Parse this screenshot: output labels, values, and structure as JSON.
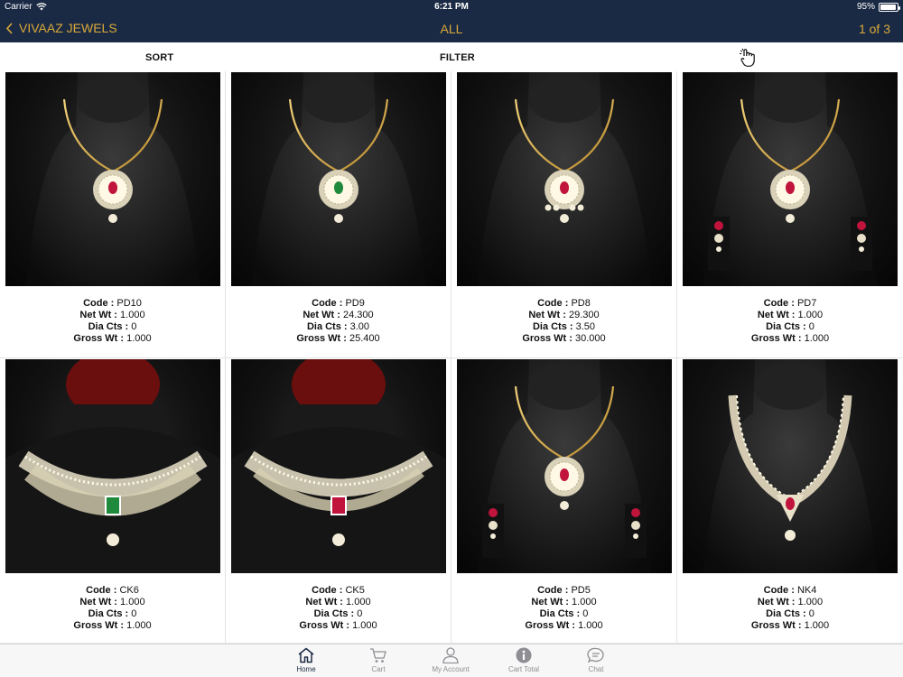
{
  "status_bar": {
    "carrier": "Carrier",
    "time": "6:21 PM",
    "battery": "95%",
    "battery_level": 0.95
  },
  "nav": {
    "back_label": "VIVAAZ JEWELS",
    "title": "ALL",
    "page_indicator": "1 of 3",
    "accent_color": "#d9a93a",
    "bg_color": "#1b2a44"
  },
  "toolbar": {
    "sort_label": "SORT",
    "filter_label": "FILTER",
    "hand_icon": "hand-pointer-icon"
  },
  "labels": {
    "code": "Code :",
    "net_wt": "Net Wt :",
    "dia_cts": "Dia Cts :",
    "gross_wt": "Gross Wt :"
  },
  "products": [
    {
      "code": "PD10",
      "net_wt": "1.000",
      "dia_cts": "0",
      "gross_wt": "1.000",
      "style": "pendant",
      "stone": "#c0143c"
    },
    {
      "code": "PD9",
      "net_wt": "24.300",
      "dia_cts": "3.00",
      "gross_wt": "25.400",
      "style": "pendant",
      "stone": "#1f8a3c"
    },
    {
      "code": "PD8",
      "net_wt": "29.300",
      "dia_cts": "3.50",
      "gross_wt": "30.000",
      "style": "pendant-drops",
      "stone": "#c0143c"
    },
    {
      "code": "PD7",
      "net_wt": "1.000",
      "dia_cts": "0",
      "gross_wt": "1.000",
      "style": "pendant-earrings",
      "stone": "#c0143c"
    },
    {
      "code": "CK6",
      "net_wt": "1.000",
      "dia_cts": "0",
      "gross_wt": "1.000",
      "style": "choker",
      "stone": "#1f8a3c"
    },
    {
      "code": "CK5",
      "net_wt": "1.000",
      "dia_cts": "0",
      "gross_wt": "1.000",
      "style": "choker-lace",
      "stone": "#c0143c"
    },
    {
      "code": "PD5",
      "net_wt": "1.000",
      "dia_cts": "0",
      "gross_wt": "1.000",
      "style": "pendant-earrings",
      "stone": "#c0143c"
    },
    {
      "code": "NK4",
      "net_wt": "1.000",
      "dia_cts": "0",
      "gross_wt": "1.000",
      "style": "necklace",
      "stone": "#c0143c"
    }
  ],
  "tabs": [
    {
      "label": "Home",
      "icon": "home-icon",
      "active": true
    },
    {
      "label": "Cart",
      "icon": "cart-icon",
      "active": false
    },
    {
      "label": "My Account",
      "icon": "user-icon",
      "active": false
    },
    {
      "label": "Cart Total",
      "icon": "info-icon",
      "active": false
    },
    {
      "label": "Chat",
      "icon": "chat-icon",
      "active": false
    }
  ]
}
